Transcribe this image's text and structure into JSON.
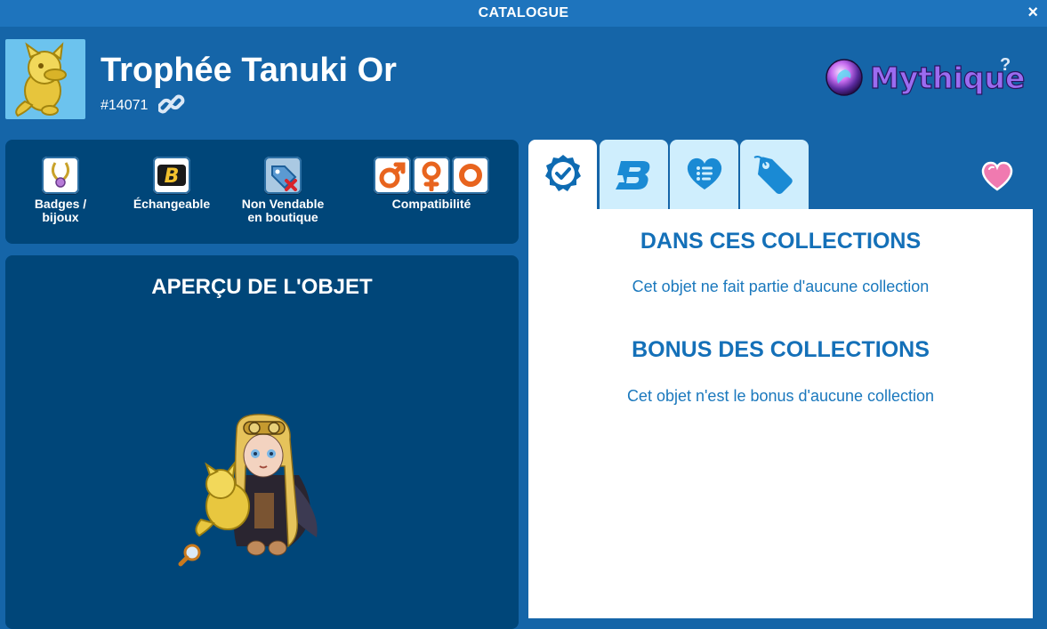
{
  "window": {
    "title": "CATALOGUE",
    "close_label": "×"
  },
  "item": {
    "name": "Trophée Tanuki Or",
    "id": "#14071",
    "rarity": "Mythique",
    "rarity_help": "?",
    "rarity_color": "#9b6cf0"
  },
  "properties": [
    {
      "label": "Badges / bijoux",
      "icon": "necklace-icon"
    },
    {
      "label": "Échangeable",
      "icon": "b-badge-icon"
    },
    {
      "label_line1": "Non Vendable",
      "label_line2": "en boutique",
      "icon": "tag-crossed-icon"
    },
    {
      "label": "Compatibilité",
      "icons": [
        "male-icon",
        "female-icon",
        "neutral-icon"
      ]
    }
  ],
  "preview": {
    "title": "APERÇU DE L'OBJET"
  },
  "tabs": [
    {
      "name": "collections",
      "icon": "check-badge-icon",
      "active": true
    },
    {
      "name": "bonus",
      "icon": "b-letter-icon",
      "active": false
    },
    {
      "name": "wishlist",
      "icon": "heart-list-icon",
      "active": false
    },
    {
      "name": "price",
      "icon": "tag-icon",
      "active": false
    }
  ],
  "collections": {
    "title": "DANS CES COLLECTIONS",
    "empty_text": "Cet objet ne fait partie d'aucune collection",
    "bonus_title": "BONUS DES COLLECTIONS",
    "bonus_empty_text": "Cet objet n'est le bonus d'aucune collection"
  },
  "colors": {
    "background": "#1565a8",
    "panel_dark": "#004679",
    "tab_inactive": "#cfeefd",
    "accent_text": "#1470b8",
    "heart": "#f07ab0"
  }
}
